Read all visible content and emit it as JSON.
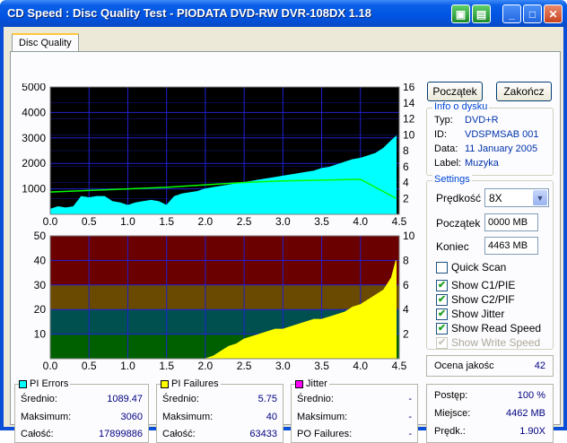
{
  "window": {
    "title": "CD Speed : Disc Quality Test - PIODATA DVD-RW DVR-108DX 1.18"
  },
  "tabs": [
    {
      "label": "Disc Quality"
    }
  ],
  "buttons": {
    "start": "Początek",
    "end": "Zakończ"
  },
  "info": {
    "title": "Info o dysku",
    "rows": [
      {
        "key": "Typ:",
        "value": "DVD+R"
      },
      {
        "key": "ID:",
        "value": "VDSPMSAB 001"
      },
      {
        "key": "Data:",
        "value": "11 January 2005"
      },
      {
        "key": "Label:",
        "value": "Muzyka"
      }
    ]
  },
  "settings": {
    "title": "Settings",
    "speed_label": "Prędkość",
    "speed_value": "8X",
    "start_label": "Początek",
    "start_value": "0000 MB",
    "end_label": "Koniec",
    "end_value": "4463 MB",
    "checks": [
      {
        "label": "Quick Scan",
        "checked": false,
        "disabled": false
      },
      {
        "label": "Show C1/PIE",
        "checked": true,
        "disabled": false
      },
      {
        "label": "Show C2/PIF",
        "checked": true,
        "disabled": false
      },
      {
        "label": "Show Jitter",
        "checked": true,
        "disabled": false
      },
      {
        "label": "Show Read Speed",
        "checked": true,
        "disabled": false
      },
      {
        "label": "Show Write Speed",
        "checked": true,
        "disabled": true
      }
    ]
  },
  "quality": {
    "label": "Ocena jakośc",
    "value": "42"
  },
  "progress": {
    "progress_label": "Postęp:",
    "progress_value": "100 %",
    "position_label": "Miejsce:",
    "position_value": "4462 MB",
    "speed_label": "Prędk.:",
    "speed_value": "1.90X"
  },
  "stats": {
    "pi_errors": {
      "title": "PI Errors",
      "color": "#00ffff",
      "avg_label": "Średnio:",
      "avg": "1089.47",
      "max_label": "Maksimum:",
      "max": "3060",
      "total_label": "Całość:",
      "total": "17899886"
    },
    "pi_failures": {
      "title": "PI Failures",
      "color": "#ffff00",
      "avg_label": "Średnio:",
      "avg": "5.75",
      "max_label": "Maksimum:",
      "max": "40",
      "total_label": "Całość:",
      "total": "63433"
    },
    "jitter": {
      "title": "Jitter",
      "color": "#ff00ff",
      "avg_label": "Średnio:",
      "avg": "-",
      "max_label": "Maksimum:",
      "max": "-",
      "po_label": "PO Failures:",
      "po": "-"
    }
  },
  "chart_data": [
    {
      "type": "area",
      "name": "PI Errors",
      "xlim": [
        0,
        4.5
      ],
      "ylim_left": [
        0,
        5000
      ],
      "ylim_right": [
        0,
        16
      ],
      "x_ticks": [
        "0.0",
        "0.5",
        "1.0",
        "1.5",
        "2.0",
        "2.5",
        "3.0",
        "3.5",
        "4.0",
        "4.5"
      ],
      "y_ticks_left": [
        "5000",
        "4000",
        "3000",
        "2000",
        "1000"
      ],
      "y_ticks_right": [
        "16",
        "14",
        "12",
        "10",
        "8",
        "6",
        "4",
        "2"
      ],
      "series": [
        {
          "color": "#00ffff",
          "x": [
            0.0,
            0.1,
            0.2,
            0.3,
            0.4,
            0.5,
            0.6,
            0.7,
            0.8,
            0.9,
            1.0,
            1.1,
            1.2,
            1.3,
            1.4,
            1.5,
            1.6,
            1.7,
            1.8,
            1.9,
            2.0,
            2.1,
            2.2,
            2.3,
            2.4,
            2.5,
            2.6,
            2.7,
            2.8,
            2.9,
            3.0,
            3.1,
            3.2,
            3.3,
            3.4,
            3.5,
            3.6,
            3.7,
            3.8,
            3.9,
            4.0,
            4.1,
            4.2,
            4.3,
            4.4,
            4.46
          ],
          "y": [
            200,
            300,
            250,
            300,
            700,
            650,
            700,
            700,
            500,
            450,
            350,
            450,
            500,
            550,
            500,
            350,
            700,
            800,
            850,
            900,
            1000,
            1050,
            1100,
            1150,
            1200,
            1250,
            1300,
            1350,
            1400,
            1450,
            1500,
            1550,
            1600,
            1650,
            1700,
            1800,
            1850,
            1950,
            2050,
            2150,
            2200,
            2300,
            2400,
            2600,
            2900,
            3060
          ]
        },
        {
          "color": "#00ff00",
          "axis": "right",
          "x": [
            0.0,
            0.5,
            1.0,
            1.5,
            2.0,
            2.5,
            3.0,
            3.5,
            4.0,
            4.46
          ],
          "y": [
            2.8,
            3.0,
            3.2,
            3.4,
            3.7,
            4.0,
            4.2,
            4.3,
            4.4,
            2.0
          ]
        }
      ]
    },
    {
      "type": "bar",
      "name": "PI Failures",
      "xlim": [
        0,
        4.5
      ],
      "ylim_left": [
        0,
        50
      ],
      "ylim_right": [
        0,
        10
      ],
      "x_ticks": [
        "0.0",
        "0.5",
        "1.0",
        "1.5",
        "2.0",
        "2.5",
        "3.0",
        "3.5",
        "4.0",
        "4.5"
      ],
      "y_ticks_left": [
        "50",
        "40",
        "30",
        "20",
        "10"
      ],
      "y_ticks_right": [
        "10",
        "8",
        "6",
        "4",
        "2"
      ],
      "series": [
        {
          "color": "#ffff00",
          "x": [
            0.0,
            2.0,
            2.1,
            2.2,
            2.3,
            2.4,
            2.5,
            2.6,
            2.7,
            2.8,
            2.9,
            3.0,
            3.1,
            3.2,
            3.3,
            3.4,
            3.5,
            3.6,
            3.7,
            3.8,
            3.9,
            4.0,
            4.1,
            4.2,
            4.3,
            4.4,
            4.46
          ],
          "y": [
            0,
            0,
            1,
            3,
            5,
            6,
            8,
            9,
            10,
            11,
            12,
            12,
            13,
            14,
            15,
            16,
            16,
            17,
            18,
            19,
            21,
            22,
            24,
            26,
            28,
            33,
            40
          ]
        }
      ]
    }
  ]
}
